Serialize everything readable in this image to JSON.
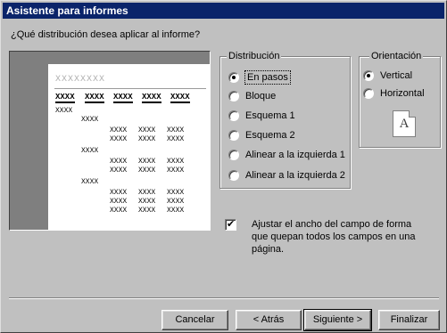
{
  "window": {
    "title": "Asistente para informes"
  },
  "prompt": "¿Qué distribución desea aplicar al informe?",
  "preview": {
    "title_placeholder": "XXXXXXXX",
    "header_row": [
      "XXXX",
      "XXXX",
      "XXXX",
      "XXXX",
      "XXXX"
    ],
    "group1": "XXXX",
    "group2": "XXXX",
    "detail": [
      "XXXX",
      "XXXX",
      "XXXX"
    ]
  },
  "distribucion": {
    "legend": "Distribución",
    "options": [
      {
        "label": "En pasos",
        "selected": true
      },
      {
        "label": "Bloque",
        "selected": false
      },
      {
        "label": "Esquema 1",
        "selected": false
      },
      {
        "label": "Esquema 2",
        "selected": false
      },
      {
        "label": "Alinear a la izquierda 1",
        "selected": false
      },
      {
        "label": "Alinear a la izquierda 2",
        "selected": false
      }
    ]
  },
  "orientacion": {
    "legend": "Orientación",
    "options": [
      {
        "label": "Vertical",
        "selected": true
      },
      {
        "label": "Horizontal",
        "selected": false
      }
    ],
    "icon_letter": "A"
  },
  "ajustar": {
    "checked": true,
    "label": "Ajustar el ancho del campo de forma que quepan todos los campos en una página."
  },
  "buttons": {
    "cancel": "Cancelar",
    "back": "< Atrás",
    "next": "Siguiente >",
    "finish": "Finalizar"
  }
}
